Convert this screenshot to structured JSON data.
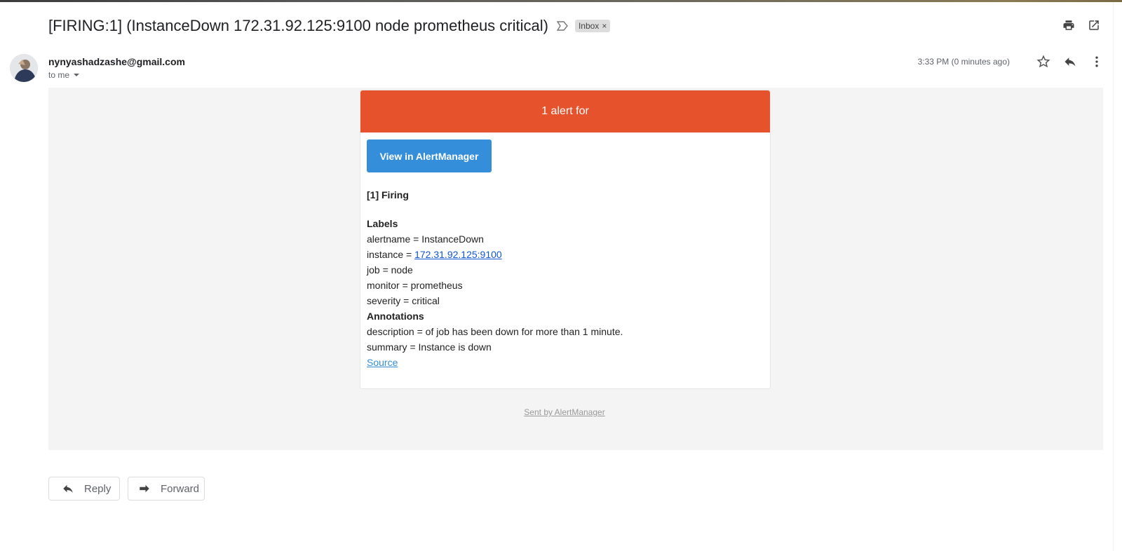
{
  "email": {
    "subject": "[FIRING:1] (InstanceDown 172.31.92.125:9100 node prometheus critical)",
    "label_chip": "Inbox",
    "label_chip_close": "×",
    "sender": "nynyashadzashe@gmail.com",
    "recipient_line": "to me",
    "timestamp": "3:33 PM (0 minutes ago)"
  },
  "icons": {
    "importance": "importance-marker-icon",
    "print": "print-icon",
    "open_new_window": "open-in-new-window-icon",
    "star": "star-icon",
    "reply": "reply-icon",
    "more": "more-vert-icon",
    "forward": "forward-icon"
  },
  "alert": {
    "header": "1 alert for",
    "header_color": "#e6522c",
    "button_label": "View in AlertManager",
    "button_color": "#348eda",
    "firing_heading": "[1] Firing",
    "labels_heading": "Labels",
    "labels": {
      "alertname": "alertname = InstanceDown",
      "instance_prefix": "instance = ",
      "instance_value": "172.31.92.125:9100",
      "job": "job = node",
      "monitor": "monitor = prometheus",
      "severity": "severity = critical"
    },
    "annotations_heading": "Annotations",
    "annotations": {
      "description": "description = of job has been down for more than 1 minute.",
      "summary": "summary = Instance is down"
    },
    "source_link": "Source",
    "footer": "Sent by AlertManager"
  },
  "actions": {
    "reply_label": "Reply",
    "forward_label": "Forward"
  }
}
